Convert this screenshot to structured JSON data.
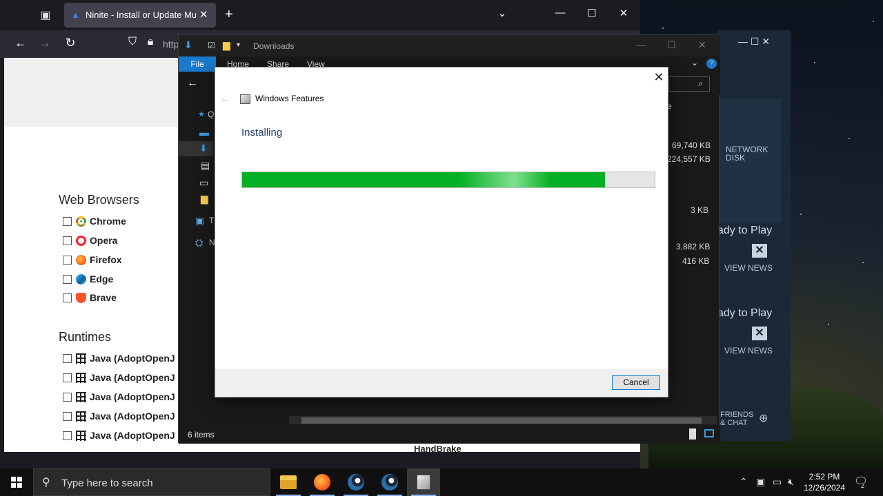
{
  "browser": {
    "tab_title": "Ninite - Install or Update Multip",
    "tab_close": "✕",
    "new_tab": "+",
    "url_partial": "http",
    "window_controls": [
      "⌄",
      "—",
      "☐",
      "✕"
    ]
  },
  "ninite": {
    "web_browsers_title": "Web Browsers",
    "browsers": [
      "Chrome",
      "Opera",
      "Firefox",
      "Edge",
      "Brave"
    ],
    "runtimes_title": "Runtimes",
    "runtimes": [
      "Java (AdoptOpenJ",
      "Java (AdoptOpenJ",
      "Java (AdoptOpenJ",
      "Java (AdoptOpenJ",
      "Java (AdoptOpenJ"
    ],
    "partial_label": "HandBrake"
  },
  "explorer": {
    "title": "Downloads",
    "ribbon": {
      "file": "File",
      "home": "Home",
      "share": "Share",
      "view": "View"
    },
    "column_fragment": "ze",
    "sidebar_fragments": [
      "Q",
      "T",
      "N"
    ],
    "sizes": [
      "69,740 KB",
      "224,557 KB",
      "3 KB",
      "3,882 KB",
      "416 KB"
    ],
    "status": "6 items"
  },
  "steam": {
    "network_disk": [
      "NETWORK",
      "DISK"
    ],
    "ready_to_play": "ady to Play",
    "view_news": "VIEW NEWS",
    "friends_chat": [
      "FRIENDS",
      "& CHAT"
    ]
  },
  "dialog": {
    "window_title": "Windows Features",
    "heading": "Installing",
    "progress_fraction": 0.88,
    "cancel_label": "Cancel",
    "close_glyph": "✕",
    "back_glyph": "←"
  },
  "taskbar": {
    "search_placeholder": "Type here to search",
    "time": "2:52 PM",
    "date": "12/26/2024",
    "notification_count": "2"
  },
  "colors": {
    "progress_green": "#06b025",
    "accent_blue": "#1979ca",
    "dialog_heading": "#1e3a78"
  }
}
